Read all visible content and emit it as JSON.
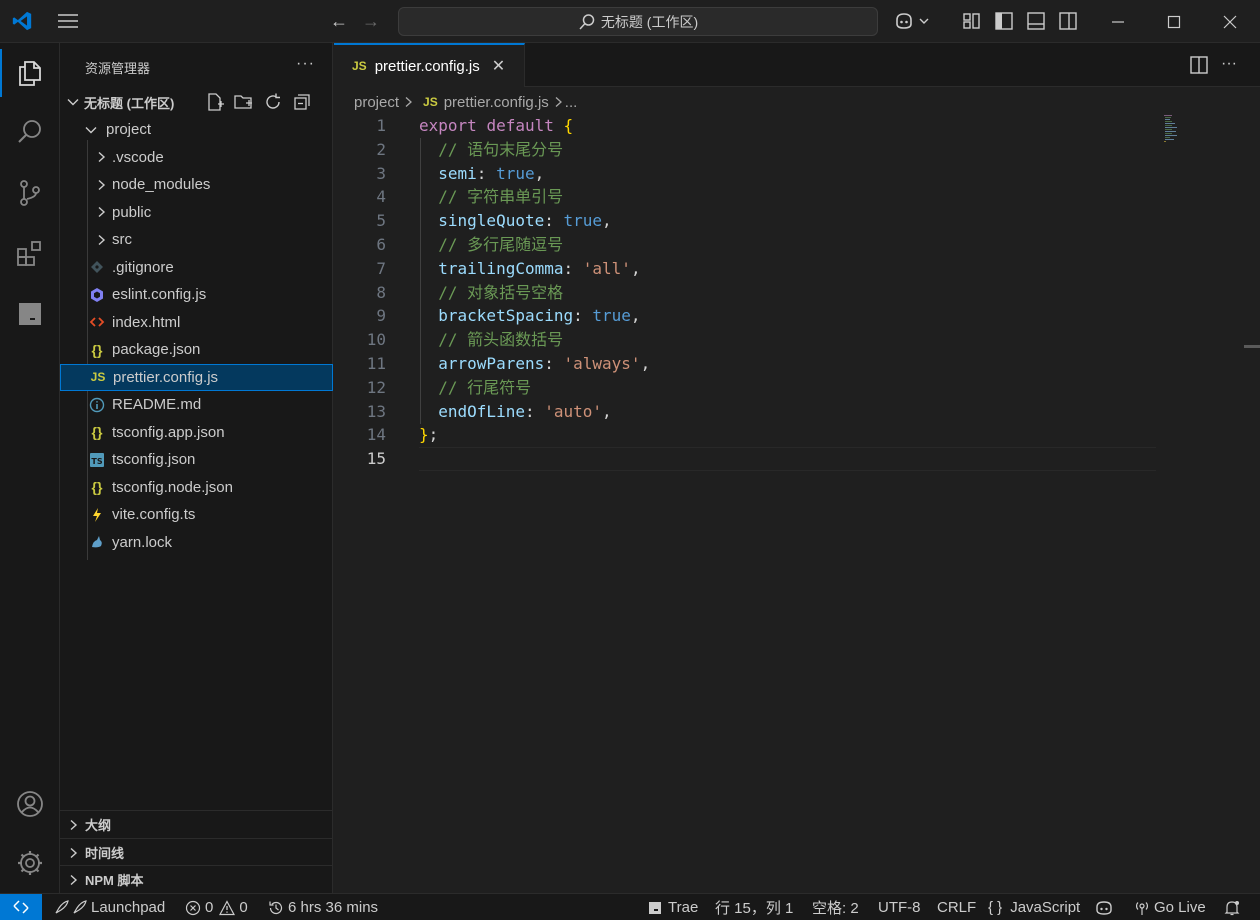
{
  "titlebar": {
    "search_text": "无标题 (工作区)"
  },
  "sidebar": {
    "title": "资源管理器",
    "more": "···",
    "workspace": "无标题 (工作区)",
    "tree": [
      {
        "label": "project",
        "kind": "folder-open",
        "icon": "chevron-down-icon"
      },
      {
        "label": ".vscode",
        "kind": "folder",
        "icon": "chevron-right-icon"
      },
      {
        "label": "node_modules",
        "kind": "folder",
        "icon": "chevron-right-icon"
      },
      {
        "label": "public",
        "kind": "folder",
        "icon": "chevron-right-icon"
      },
      {
        "label": "src",
        "kind": "folder",
        "icon": "chevron-right-icon"
      },
      {
        "label": ".gitignore",
        "kind": "file",
        "icon": "git-icon"
      },
      {
        "label": "eslint.config.js",
        "kind": "file",
        "icon": "eslint-icon"
      },
      {
        "label": "index.html",
        "kind": "file",
        "icon": "html-icon"
      },
      {
        "label": "package.json",
        "kind": "file",
        "icon": "json-icon"
      },
      {
        "label": "prettier.config.js",
        "kind": "file",
        "icon": "js-icon",
        "selected": true
      },
      {
        "label": "README.md",
        "kind": "file",
        "icon": "info-icon"
      },
      {
        "label": "tsconfig.app.json",
        "kind": "file",
        "icon": "json-icon"
      },
      {
        "label": "tsconfig.json",
        "kind": "file",
        "icon": "ts-icon"
      },
      {
        "label": "tsconfig.node.json",
        "kind": "file",
        "icon": "json-icon"
      },
      {
        "label": "vite.config.ts",
        "kind": "file",
        "icon": "vite-icon"
      },
      {
        "label": "yarn.lock",
        "kind": "file",
        "icon": "yarn-icon"
      }
    ],
    "sections": [
      "大纲",
      "时间线",
      "NPM 脚本"
    ]
  },
  "editor": {
    "tab_label": "prettier.config.js",
    "tab_icon_text": "JS",
    "breadcrumb": [
      "project",
      "prettier.config.js",
      "..."
    ],
    "current_line": 15,
    "lines": [
      "export default {",
      "  // 语句末尾分号",
      "  semi: true,",
      "  // 字符串单引号",
      "  singleQuote: true,",
      "  // 多行尾随逗号",
      "  trailingComma: 'all',",
      "  // 对象括号空格",
      "  bracketSpacing: true,",
      "  // 箭头函数括号",
      "  arrowParens: 'always',",
      "  // 行尾符号",
      "  endOfLine: 'auto',",
      "};",
      ""
    ]
  },
  "statusbar": {
    "launchpad": "Launchpad",
    "errors": "0",
    "warnings": "0",
    "time": "6 hrs 36 mins",
    "trae": "Trae",
    "position": "行 15，列 1",
    "spaces": "空格: 2",
    "encoding": "UTF-8",
    "eol": "CRLF",
    "language": "JavaScript",
    "language_icon": "{ }",
    "golive": "Go Live"
  },
  "colors": {
    "accent": "#0078d4",
    "keyword": "#c586c0",
    "keyword_blue": "#569cd6",
    "comment": "#6a9955",
    "property": "#9cdcfe",
    "string": "#ce9178",
    "bracket": "#ffd700"
  }
}
